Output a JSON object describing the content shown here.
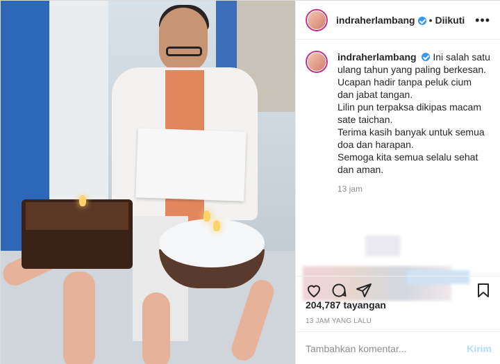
{
  "post": {
    "username": "indraherlambang",
    "follow_status": "Diikuti",
    "caption": {
      "lines": [
        "Ini salah satu ulang tahun yang paling berkesan.",
        "Ucapan hadir tanpa peluk cium dan jabat tangan.",
        "Lilin pun terpaksa dikipas macam sate taichan.",
        "Terima kasih banyak untuk semua doa dan harapan.",
        "Semoga kita semua selalu sehat dan aman."
      ],
      "time": "13 jam"
    },
    "views": "204,787 tayangan",
    "date": "13 JAM YANG LALU",
    "comment_placeholder": "Tambahkan komentar...",
    "post_label": "Kirim"
  },
  "colors": {
    "verified": "#3897f0",
    "post_disabled": "#b3dbff",
    "secondary_text": "#8e8e8e",
    "border": "#efefef"
  },
  "icons": [
    "more-icon",
    "heart-icon",
    "comment-icon",
    "share-icon",
    "bookmark-icon",
    "verified-badge-icon"
  ]
}
